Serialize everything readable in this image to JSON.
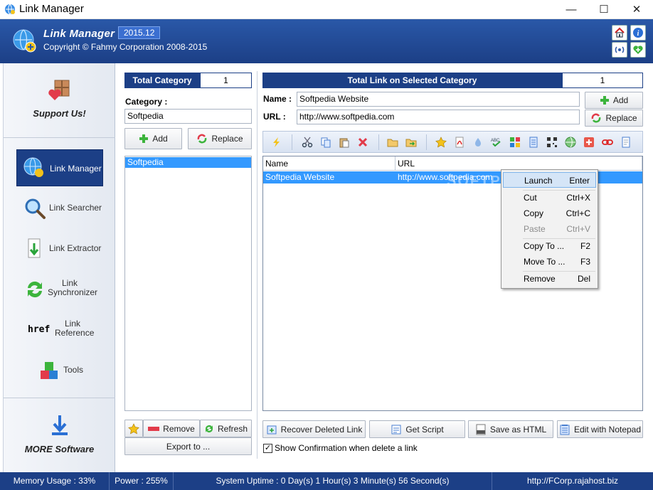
{
  "window": {
    "title": "Link Manager",
    "minimize": "—",
    "maximize": "☐",
    "close": "✕"
  },
  "header": {
    "brand": "Link Manager",
    "version": "2015.12",
    "copyright": "Copyright © Fahmy Corporation 2008-2015"
  },
  "sidebar": {
    "support": "Support Us!",
    "items": [
      {
        "label": "Link Manager",
        "icon": "globe-link-icon",
        "active": true
      },
      {
        "label": "Link Searcher",
        "icon": "magnifier-icon"
      },
      {
        "label": "Link Extractor",
        "icon": "extract-down-icon"
      },
      {
        "label": "Link\nSynchronizer",
        "icon": "sync-arrows-icon"
      },
      {
        "label": "Link\nReference",
        "icon": "href-icon",
        "icon_text": "href"
      },
      {
        "label": "Tools",
        "icon": "cubes-icon"
      }
    ],
    "more": "MORE Software"
  },
  "category": {
    "total_label": "Total Category",
    "total_value": "1",
    "label": "Category :",
    "value": "Softpedia",
    "add": "Add",
    "replace": "Replace",
    "items": [
      "Softpedia"
    ],
    "remove": "Remove",
    "refresh": "Refresh",
    "export": "Export to ..."
  },
  "links": {
    "total_label": "Total Link on Selected Category",
    "total_value": "1",
    "name_label": "Name :",
    "name_value": "Softpedia Website",
    "url_label": "URL :",
    "url_value": "http://www.softpedia.com",
    "add": "Add",
    "replace": "Replace",
    "columns": [
      "Name",
      "URL"
    ],
    "rows": [
      {
        "name": "Softpedia Website",
        "url": "http://www.softpedia.com"
      }
    ]
  },
  "watermark": "SOFTPEDIA",
  "context_menu": [
    {
      "label": "Launch",
      "shortcut": "Enter",
      "highlight": true
    },
    {
      "label": "Cut",
      "shortcut": "Ctrl+X"
    },
    {
      "label": "Copy",
      "shortcut": "Ctrl+C"
    },
    {
      "label": "Paste",
      "shortcut": "Ctrl+V",
      "disabled": true
    },
    {
      "label": "Copy To ...",
      "shortcut": "F2"
    },
    {
      "label": "Move To ...",
      "shortcut": "F3"
    },
    {
      "label": "Remove",
      "shortcut": "Del"
    }
  ],
  "actions": {
    "recover": "Recover Deleted Link",
    "script": "Get Script",
    "html": "Save as HTML",
    "notepad": "Edit with Notepad",
    "confirm": "Show Confirmation when delete a link"
  },
  "status": {
    "memory": "Memory Usage : 33%",
    "power": "Power : 255%",
    "uptime": "System Uptime : 0 Day(s) 1 Hour(s) 3 Minute(s) 56 Second(s)",
    "url": "http://FCorp.rajahost.biz"
  },
  "colors": {
    "accent": "#1c3f86",
    "selection": "#3399ff"
  }
}
